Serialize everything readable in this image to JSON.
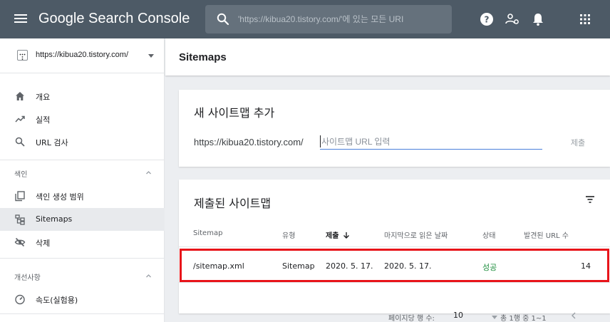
{
  "topbar": {
    "brand": "Google Search Console",
    "search_placeholder": "'https://kibua20.tistory.com/'에 있는 모든 URI",
    "icons": [
      "menu-icon",
      "search-icon",
      "help-icon",
      "manage-users-icon",
      "notifications-icon",
      "apps-icon"
    ]
  },
  "sidebar": {
    "property": "https://kibua20.tistory.com/",
    "items": [
      {
        "label": "개요",
        "icon": "home-icon"
      },
      {
        "label": "실적",
        "icon": "trending-icon"
      },
      {
        "label": "URL 검사",
        "icon": "search-icon"
      }
    ],
    "index_section": {
      "label": "색인",
      "items": [
        {
          "label": "색인 생성 범위",
          "icon": "coverage-icon"
        },
        {
          "label": "Sitemaps",
          "icon": "sitemap-icon",
          "active": true
        },
        {
          "label": "삭제",
          "icon": "removals-icon"
        }
      ]
    },
    "enhancements_section": {
      "label": "개선사항",
      "items": [
        {
          "label": "속도(실험용)",
          "icon": "speed-icon"
        }
      ]
    }
  },
  "main": {
    "page_title": "Sitemaps",
    "add_card": {
      "title": "새 사이트맵 추가",
      "url_prefix": "https://kibua20.tistory.com/",
      "input_placeholder": "사이트맵 URL 입력",
      "submit_label": "제출"
    },
    "submitted_card": {
      "title": "제출된 사이트맵",
      "columns": [
        "Sitemap",
        "유형",
        "제출",
        "마지막으로 읽은 날짜",
        "상태",
        "발견된 URL 수"
      ],
      "rows": [
        {
          "sitemap": "/sitemap.xml",
          "type": "Sitemap",
          "submitted": "2020. 5. 17.",
          "last_read": "2020. 5. 17.",
          "status": "성공",
          "discovered_urls": "14"
        }
      ],
      "pagination": {
        "rows_per_page_label": "페이지당 행 수:",
        "rows_per_page_value": "10",
        "range_label": "총 1행 중 1~1"
      }
    }
  },
  "colors": {
    "topbar": "#4d5a66",
    "status_success": "#1e8e3e",
    "highlight": "#e8141a",
    "input_underline": "#4a80dc"
  }
}
